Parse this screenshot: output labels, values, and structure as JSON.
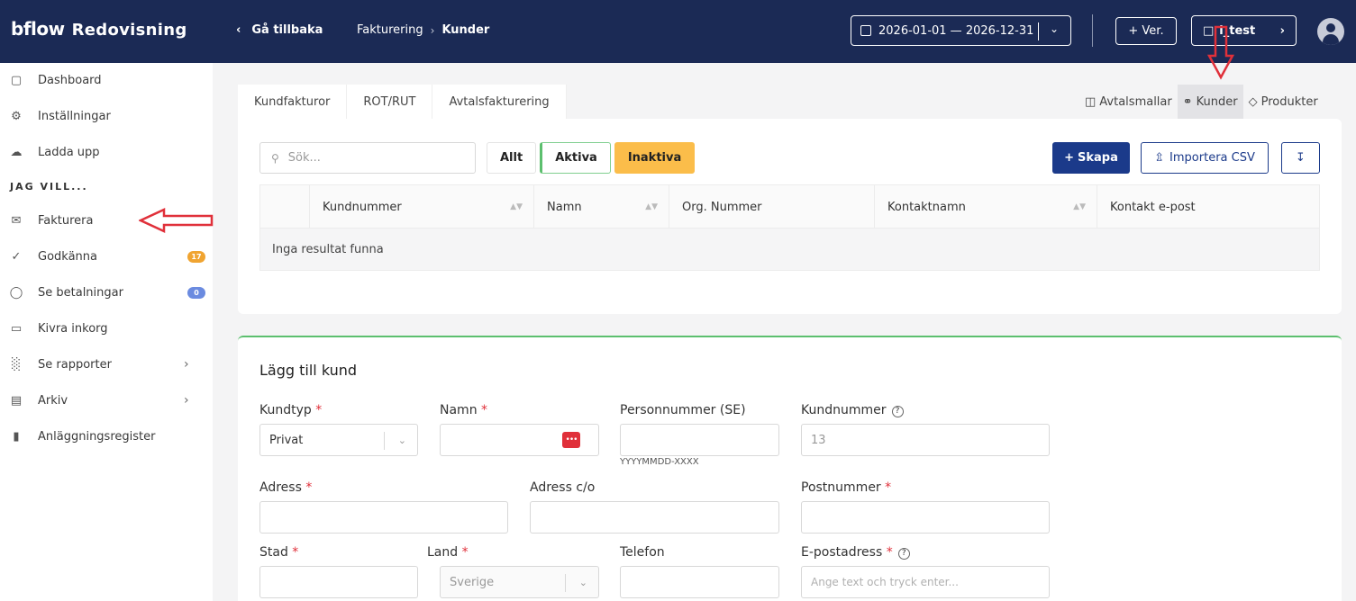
{
  "header": {
    "logo": "bflow",
    "product": "Redovisning",
    "back_label": "Gå tillbaka",
    "breadcrumb": [
      "Fakturering",
      "Kunder"
    ],
    "date_range": "2026-01-01 — 2026-12-31",
    "ver_label": "+ Ver.",
    "company_label": "l_test"
  },
  "sidebar": {
    "items": [
      {
        "label": "Dashboard",
        "icon": "monitor-icon"
      },
      {
        "label": "Inställningar",
        "icon": "gear-icon"
      },
      {
        "label": "Ladda upp",
        "icon": "upload-cloud-icon"
      }
    ],
    "section_title": "JAG VILL...",
    "actions": [
      {
        "label": "Fakturera",
        "icon": "mail-icon"
      },
      {
        "label": "Godkänna",
        "icon": "check-icon",
        "badge": "17",
        "badge_color": "#f0a431"
      },
      {
        "label": "Se betalningar",
        "icon": "check-circle-icon",
        "badge": "0",
        "badge_color": "#6b8be0"
      },
      {
        "label": "Kivra inkorg",
        "icon": "inbox-icon"
      },
      {
        "label": "Se rapporter",
        "icon": "bar-chart-icon"
      },
      {
        "label": "Arkiv",
        "icon": "archive-icon"
      },
      {
        "label": "Anläggningsregister",
        "icon": "files-icon"
      }
    ]
  },
  "tabs": [
    "Kundfakturor",
    "ROT/RUT",
    "Avtalsfakturering"
  ],
  "right_tabs": [
    "Avtalsmallar",
    "Kunder",
    "Produkter"
  ],
  "toolbar": {
    "search_placeholder": "Sök...",
    "filter_all": "Allt",
    "filter_active": "Aktiva",
    "filter_inactive": "Inaktiva",
    "create_label": "Skapa",
    "import_label": "Importera CSV"
  },
  "table": {
    "columns": [
      "Kundnummer",
      "Namn",
      "Org. Nummer",
      "Kontaktnamn",
      "Kontakt e-post"
    ],
    "empty_text": "Inga resultat funna"
  },
  "form": {
    "title": "Lägg till kund",
    "kundtyp_label": "Kundtyp",
    "kundtyp_value": "Privat",
    "namn_label": "Namn",
    "personnummer_label": "Personnummer (SE)",
    "personnummer_hint": "YYYYMMDD-XXXX",
    "kundnummer_label": "Kundnummer",
    "kundnummer_value": "13",
    "adress_label": "Adress",
    "adress_co_label": "Adress c/o",
    "postnummer_label": "Postnummer",
    "stad_label": "Stad",
    "land_label": "Land",
    "land_value": "Sverige",
    "telefon_label": "Telefon",
    "epost_label": "E-postadress",
    "epost_placeholder": "Ange text och tryck enter...",
    "required_mark": "*"
  },
  "colors": {
    "topbar": "#1b2a55",
    "primary": "#1b3a8a",
    "inactive_filter": "#fbbd4a",
    "accent_green": "#5cbf6e",
    "annotation_red": "#e0303a"
  }
}
